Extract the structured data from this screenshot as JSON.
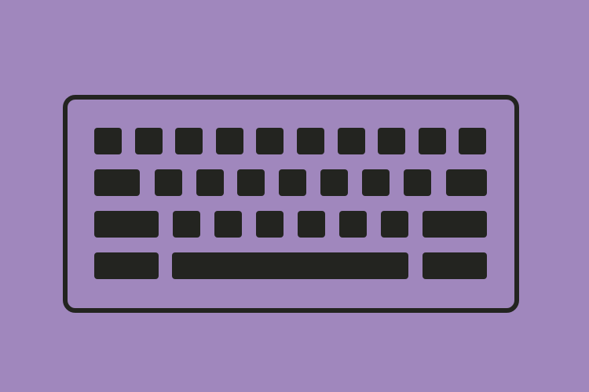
{
  "illustration": {
    "subject": "keyboard-icon",
    "colors": {
      "background": "#a087bd",
      "ink": "#232420"
    },
    "rows": [
      {
        "keys": 10
      },
      {
        "keys": 9
      },
      {
        "keys": 8
      },
      {
        "keys": 3
      }
    ]
  }
}
